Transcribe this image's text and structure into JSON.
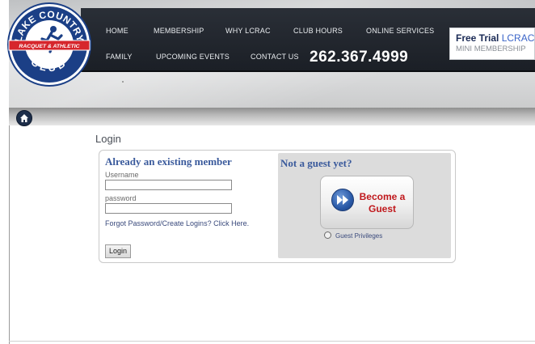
{
  "logo": {
    "line1": "LAKE COUNTRY",
    "banner": "RACQUET & ATHLETIC",
    "line2": "CLUB"
  },
  "nav": {
    "row1": [
      "HOME",
      "MEMBERSHIP",
      "WHY LCRAC",
      "CLUB HOURS",
      "ONLINE SERVICES"
    ],
    "row2": [
      "FAMILY",
      "UPCOMING EVENTS",
      "CONTACT US"
    ],
    "phone": "262.367.4999"
  },
  "trial": {
    "part1": "Free Trial ",
    "part2": "LCRAC",
    "line2": "MINI MEMBERSHIP"
  },
  "login": {
    "title": "Login",
    "existing_title": "Already an existing member",
    "username_label": "Username",
    "password_label": "password",
    "username_value": "",
    "password_value": "",
    "forgot_text": "Forgot Password/Create Logins? Click Here.",
    "login_button": "Login"
  },
  "guest": {
    "title": "Not a guest yet?",
    "button_line1": "Become a",
    "button_line2": "Guest",
    "privileges": "Guest Privileges"
  },
  "icons": {
    "home": "home-icon",
    "play": "play-icon",
    "bullet": "circle-bullet-icon"
  },
  "colors": {
    "nav_bg": "#1f242c",
    "heading_blue": "#3a5a9c",
    "guest_red": "#c0181c",
    "logo_blue": "#1b3f86"
  }
}
